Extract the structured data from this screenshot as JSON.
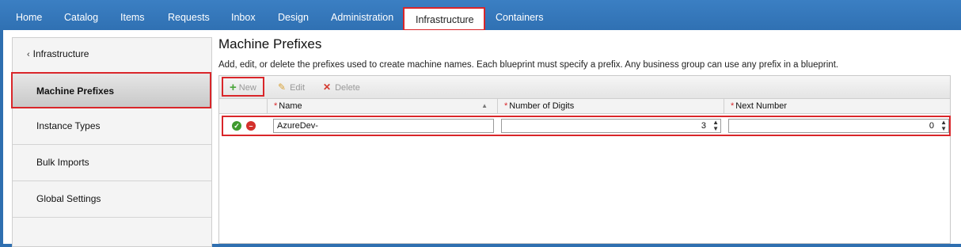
{
  "nav": {
    "tabs": [
      "Home",
      "Catalog",
      "Items",
      "Requests",
      "Inbox",
      "Design",
      "Administration",
      "Infrastructure",
      "Containers"
    ],
    "active_tab": "Infrastructure"
  },
  "sidebar": {
    "back_label": "Infrastructure",
    "items": [
      "Machine Prefixes",
      "Instance Types",
      "Bulk Imports",
      "Global Settings"
    ],
    "active_item": "Machine Prefixes"
  },
  "main": {
    "title": "Machine Prefixes",
    "description": "Add, edit, or delete the prefixes used to create machine names. Each blueprint must specify a prefix. Any business group can use any prefix in a blueprint."
  },
  "toolbar": {
    "new_label": "New",
    "edit_label": "Edit",
    "delete_label": "Delete"
  },
  "table": {
    "columns": [
      "Name",
      "Number of Digits",
      "Next Number"
    ],
    "required_marker": "*",
    "edit_row": {
      "name": "AzureDev-",
      "digits": "3",
      "next_number": "0"
    }
  },
  "colors": {
    "nav_bg": "#2f70b2",
    "highlight": "#d9262a",
    "ok": "#3f9a2e",
    "cancel": "#d3302b"
  },
  "icons": [
    "plus-icon",
    "pencil-icon",
    "x-icon",
    "sort-asc-icon",
    "checkmark-icon",
    "cancel-icon",
    "spinner-icon",
    "chevron-left-icon"
  ]
}
